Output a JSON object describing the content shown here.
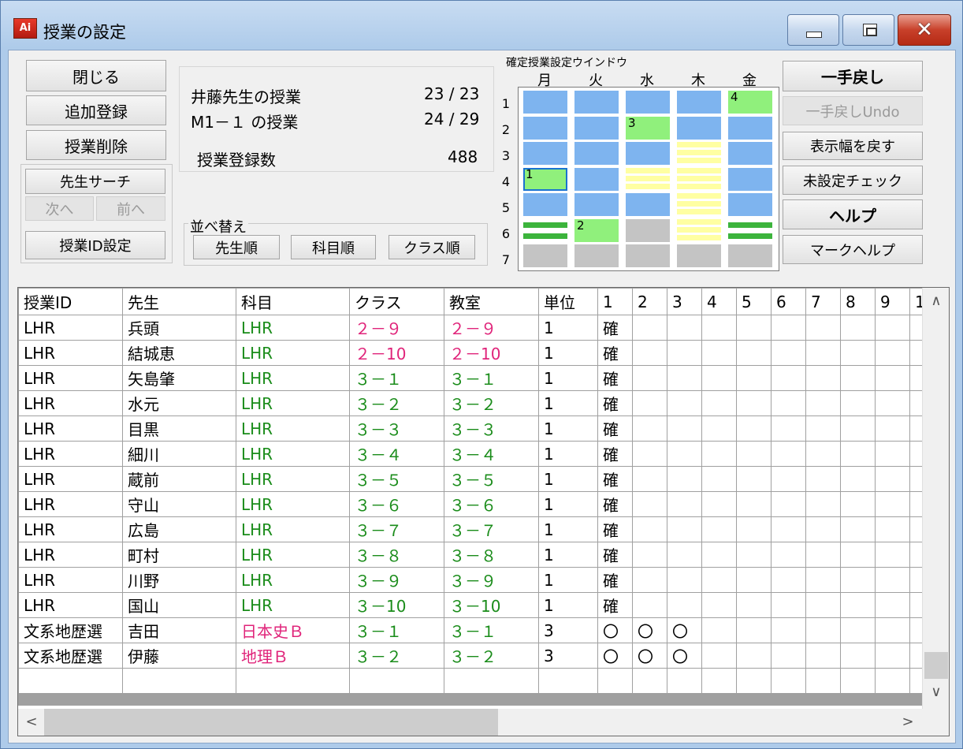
{
  "window": {
    "title": "授業の設定",
    "app_icon_text": "Ai",
    "icons": {
      "minimize": "minimize-icon",
      "maximize": "maximize-icon",
      "close": "close-icon"
    }
  },
  "left_buttons": {
    "close": "閉じる",
    "add": "追加登録",
    "delete": "授業削除",
    "teacher_search": "先生サーチ",
    "next": "次へ",
    "prev": "前へ",
    "class_id_setting": "授業ID設定"
  },
  "info": {
    "teacher_label": "井藤先生の授業",
    "teacher_count": "23 / 23",
    "class_label": "M1－１ の授業",
    "class_count": "24 / 29",
    "total_label": "授業登録数",
    "total_value": "488"
  },
  "sort": {
    "label": "並べ替え",
    "by_teacher": "先生順",
    "by_subject": "科目順",
    "by_class": "クラス順"
  },
  "confirmed_grid": {
    "title": "確定授業設定ウインドウ",
    "days": [
      "月",
      "火",
      "水",
      "木",
      "金"
    ],
    "periods": [
      "1",
      "2",
      "3",
      "4",
      "5",
      "6",
      "7"
    ],
    "cells": [
      [
        "blue",
        "blue",
        "blue",
        "blue",
        "green"
      ],
      [
        "blue",
        "blue",
        "green",
        "blue",
        "blue"
      ],
      [
        "blue",
        "blue",
        "blue",
        "yellow",
        "blue"
      ],
      [
        "green-sel",
        "blue",
        "yellow",
        "yellow",
        "blue"
      ],
      [
        "blue",
        "blue",
        "blue",
        "yellow",
        "blue"
      ],
      [
        "green-stripe",
        "green",
        "gray",
        "yellow",
        "green-stripe"
      ],
      [
        "gray",
        "gray",
        "gray",
        "gray",
        "gray"
      ]
    ],
    "markers": [
      {
        "period": 1,
        "day": 4,
        "text": "4"
      },
      {
        "period": 2,
        "day": 2,
        "text": "3"
      },
      {
        "period": 4,
        "day": 0,
        "text": "1"
      },
      {
        "period": 6,
        "day": 1,
        "text": "2"
      }
    ]
  },
  "right_buttons": {
    "undo": "一手戻し",
    "undo_undo": "一手戻しUndo",
    "reset_width": "表示幅を戻す",
    "unset_check": "未設定チェック",
    "help": "ヘルプ",
    "mark_help": "マークヘルプ"
  },
  "table": {
    "headers": [
      "授業ID",
      "先生",
      "科目",
      "クラス",
      "教室",
      "単位",
      "1",
      "2",
      "3",
      "4",
      "5",
      "6",
      "7",
      "8",
      "9",
      "1"
    ],
    "rows": [
      {
        "id": "LHR",
        "teacher": "兵頭",
        "subject": "LHR",
        "class": "２－９",
        "room": "２－９",
        "unit": "1",
        "marks": [
          "確",
          "",
          "",
          "",
          "",
          "",
          "",
          "",
          "",
          ""
        ],
        "subject_color": "green",
        "class_color": "pink"
      },
      {
        "id": "LHR",
        "teacher": "結城恵",
        "subject": "LHR",
        "class": "２－10",
        "room": "２－10",
        "unit": "1",
        "marks": [
          "確",
          "",
          "",
          "",
          "",
          "",
          "",
          "",
          "",
          ""
        ],
        "subject_color": "green",
        "class_color": "pink"
      },
      {
        "id": "LHR",
        "teacher": "矢島肇",
        "subject": "LHR",
        "class": "３－１",
        "room": "３－１",
        "unit": "1",
        "marks": [
          "確",
          "",
          "",
          "",
          "",
          "",
          "",
          "",
          "",
          ""
        ],
        "subject_color": "green",
        "class_color": "green"
      },
      {
        "id": "LHR",
        "teacher": "水元",
        "subject": "LHR",
        "class": "３－２",
        "room": "３－２",
        "unit": "1",
        "marks": [
          "確",
          "",
          "",
          "",
          "",
          "",
          "",
          "",
          "",
          ""
        ],
        "subject_color": "green",
        "class_color": "green"
      },
      {
        "id": "LHR",
        "teacher": "目黒",
        "subject": "LHR",
        "class": "３－３",
        "room": "３－３",
        "unit": "1",
        "marks": [
          "確",
          "",
          "",
          "",
          "",
          "",
          "",
          "",
          "",
          ""
        ],
        "subject_color": "green",
        "class_color": "green"
      },
      {
        "id": "LHR",
        "teacher": "細川",
        "subject": "LHR",
        "class": "３－４",
        "room": "３－４",
        "unit": "1",
        "marks": [
          "確",
          "",
          "",
          "",
          "",
          "",
          "",
          "",
          "",
          ""
        ],
        "subject_color": "green",
        "class_color": "green"
      },
      {
        "id": "LHR",
        "teacher": "蔵前",
        "subject": "LHR",
        "class": "３－５",
        "room": "３－５",
        "unit": "1",
        "marks": [
          "確",
          "",
          "",
          "",
          "",
          "",
          "",
          "",
          "",
          ""
        ],
        "subject_color": "green",
        "class_color": "green"
      },
      {
        "id": "LHR",
        "teacher": "守山",
        "subject": "LHR",
        "class": "３－６",
        "room": "３－６",
        "unit": "1",
        "marks": [
          "確",
          "",
          "",
          "",
          "",
          "",
          "",
          "",
          "",
          ""
        ],
        "subject_color": "green",
        "class_color": "green"
      },
      {
        "id": "LHR",
        "teacher": "広島",
        "subject": "LHR",
        "class": "３－７",
        "room": "３－７",
        "unit": "1",
        "marks": [
          "確",
          "",
          "",
          "",
          "",
          "",
          "",
          "",
          "",
          ""
        ],
        "subject_color": "green",
        "class_color": "green"
      },
      {
        "id": "LHR",
        "teacher": "町村",
        "subject": "LHR",
        "class": "３－８",
        "room": "３－８",
        "unit": "1",
        "marks": [
          "確",
          "",
          "",
          "",
          "",
          "",
          "",
          "",
          "",
          ""
        ],
        "subject_color": "green",
        "class_color": "green"
      },
      {
        "id": "LHR",
        "teacher": "川野",
        "subject": "LHR",
        "class": "３－９",
        "room": "３－９",
        "unit": "1",
        "marks": [
          "確",
          "",
          "",
          "",
          "",
          "",
          "",
          "",
          "",
          ""
        ],
        "subject_color": "green",
        "class_color": "green"
      },
      {
        "id": "LHR",
        "teacher": "国山",
        "subject": "LHR",
        "class": "３－10",
        "room": "３－10",
        "unit": "1",
        "marks": [
          "確",
          "",
          "",
          "",
          "",
          "",
          "",
          "",
          "",
          ""
        ],
        "subject_color": "green",
        "class_color": "green"
      },
      {
        "id": "文系地歴選",
        "teacher": "吉田",
        "subject": "日本史Ｂ",
        "class": "３－１",
        "room": "３－１",
        "unit": "3",
        "marks": [
          "〇",
          "〇",
          "〇",
          "",
          "",
          "",
          "",
          "",
          "",
          ""
        ],
        "subject_color": "pink",
        "class_color": "green"
      },
      {
        "id": "文系地歴選",
        "teacher": "伊藤",
        "subject": "地理Ｂ",
        "class": "３－２",
        "room": "３－２",
        "unit": "3",
        "marks": [
          "〇",
          "〇",
          "〇",
          "",
          "",
          "",
          "",
          "",
          "",
          ""
        ],
        "subject_color": "pink",
        "class_color": "green"
      }
    ]
  },
  "scrollbars": {
    "up": "∧",
    "down": "∨",
    "left": "<",
    "right": ">"
  }
}
